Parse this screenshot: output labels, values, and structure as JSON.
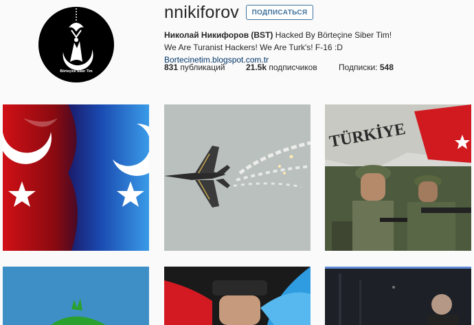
{
  "profile": {
    "username": "nnikiforov",
    "follow_label": "ПОДПИСАТЬСЯ",
    "full_name": "Николай Никифоров (BST)",
    "bio_text": " Hacked By Börteçine Siber Tim! We Are Turanist Hackers! We Are Turk's! F-16 :D ",
    "link": "Bortecinetim.blogspot.com.tr",
    "avatar_caption": "Börteçine Siber Tim"
  },
  "stats": {
    "posts_count": "831",
    "posts_label": " публикаций",
    "followers_count": "21.5k",
    "followers_label": " подписчиков",
    "following_label": "Подписки: ",
    "following_count": "548"
  },
  "posts": {
    "post3_text": "TÜRKİYE"
  },
  "colors": {
    "link": "#003569",
    "follow_button": "#3f729b",
    "background": "#fafafa"
  }
}
